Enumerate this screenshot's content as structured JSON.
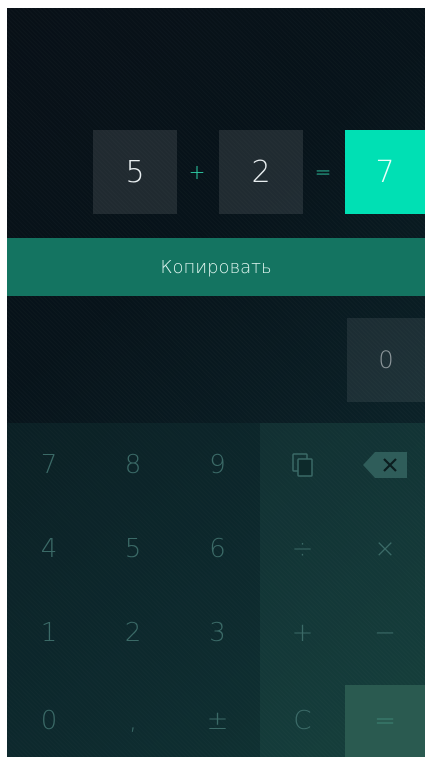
{
  "calc": {
    "operand1": "5",
    "operator": "+",
    "operand2": "2",
    "equals": "=",
    "result": "7"
  },
  "copy_button": {
    "label": "Копировать"
  },
  "display": {
    "value": "0"
  },
  "keypad": {
    "keys": [
      {
        "label": "7"
      },
      {
        "label": "8"
      },
      {
        "label": "9"
      },
      {
        "label": ""
      },
      {
        "label": ""
      },
      {
        "label": "4"
      },
      {
        "label": "5"
      },
      {
        "label": "6"
      },
      {
        "label": "÷"
      },
      {
        "label": "×"
      },
      {
        "label": "1"
      },
      {
        "label": "2"
      },
      {
        "label": "3"
      },
      {
        "label": "+"
      },
      {
        "label": "−"
      },
      {
        "label": "0"
      },
      {
        "label": ","
      },
      {
        "label": "±"
      },
      {
        "label": "C"
      },
      {
        "label": "="
      }
    ]
  },
  "icons": {
    "paste": "paste-icon",
    "backspace": "backspace-icon"
  },
  "colors": {
    "accent": "#00e0b4",
    "copy_bar": "#147461",
    "key_text": "#3b6a67"
  }
}
